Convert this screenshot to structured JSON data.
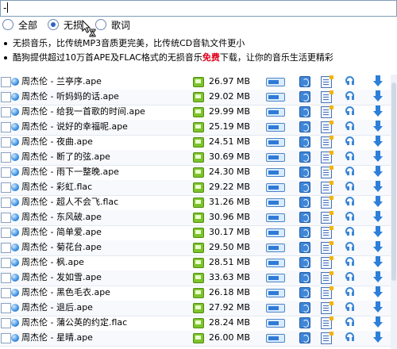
{
  "search": {
    "value": "-"
  },
  "modes": [
    {
      "label": "全部",
      "checked": false
    },
    {
      "label": "无损",
      "checked": true
    },
    {
      "label": "歌词",
      "checked": false
    }
  ],
  "info": {
    "line1": "无损音乐，比传统MP3音质更完美，比传统CD音轨文件更小",
    "line2_before": "酷狗提供超过10万首APE及FLAC格式的无损音乐",
    "line2_highlight": "免费",
    "line2_after": "下载，让你的音乐生活更精彩"
  },
  "songs": [
    {
      "name": "周杰伦 - 兰亭序.ape",
      "size": "26.97 MB"
    },
    {
      "name": "周杰伦 - 听妈妈的话.ape",
      "size": "29.02 MB"
    },
    {
      "name": "周杰伦 - 给我一首歌的时间.ape",
      "size": "29.99 MB"
    },
    {
      "name": "周杰伦 - 说好的幸福呢.ape",
      "size": "25.19 MB"
    },
    {
      "name": "周杰伦 - 夜曲.ape",
      "size": "24.51 MB"
    },
    {
      "name": "周杰伦 - 断了的弦.ape",
      "size": "30.69 MB"
    },
    {
      "name": "周杰伦 - 雨下一整晚.ape",
      "size": "24.30 MB"
    },
    {
      "name": "周杰伦 - 彩虹.flac",
      "size": "29.22 MB"
    },
    {
      "name": "周杰伦 - 超人不会飞.flac",
      "size": "31.26 MB"
    },
    {
      "name": "周杰伦 - 东风破.ape",
      "size": "30.96 MB"
    },
    {
      "name": "周杰伦 - 简单爱.ape",
      "size": "30.17 MB"
    },
    {
      "name": "周杰伦 - 菊花台.ape",
      "size": "29.50 MB"
    },
    {
      "name": "周杰伦 - 枫.ape",
      "size": "28.51 MB"
    },
    {
      "name": "周杰伦 - 发如雪.ape",
      "size": "33.63 MB"
    },
    {
      "name": "周杰伦 - 黑色毛衣.ape",
      "size": "26.18 MB"
    },
    {
      "name": "周杰伦 - 退后.ape",
      "size": "27.92 MB"
    },
    {
      "name": "周杰伦 - 蒲公英的约定.flac",
      "size": "28.24 MB"
    },
    {
      "name": "周杰伦 - 星晴.ape",
      "size": "26.00 MB"
    }
  ]
}
